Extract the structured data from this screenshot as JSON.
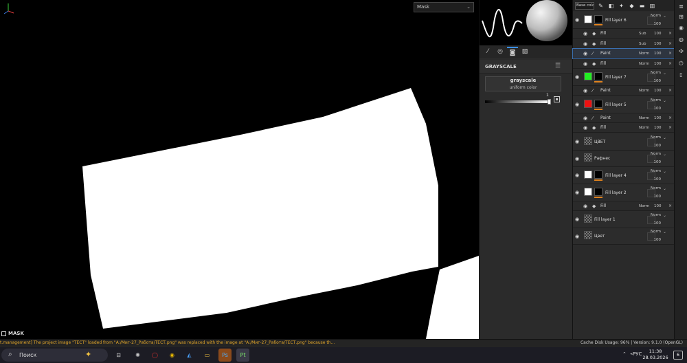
{
  "viewport": {
    "mask_dropdown": "Mask",
    "mode_label": "MASK"
  },
  "properties": {
    "section_title": "GRAYSCALE",
    "grayscale_name": "grayscale",
    "grayscale_sub": "uniform color",
    "slider_value": "1"
  },
  "layers": {
    "toolbar_blend": "Base colo",
    "items": [
      {
        "name": "Fill layer 6",
        "blend": "Norm",
        "opacity": "100",
        "thumb": "#ffffff",
        "orange": true
      },
      {
        "name": "Fill",
        "blend": "Sub",
        "opacity": "100",
        "icon": "fill-icon"
      },
      {
        "name": "Fill",
        "blend": "Sub",
        "opacity": "100",
        "icon": "fill-icon"
      },
      {
        "name": "Paint",
        "blend": "Norm",
        "opacity": "100",
        "icon": "brush-icon"
      },
      {
        "name": "Fill",
        "blend": "Norm",
        "opacity": "100",
        "icon": "fill-icon"
      },
      {
        "name": "Fill layer 7",
        "blend": "Norm",
        "opacity": "100",
        "thumb": "#22ee22",
        "orange": true
      },
      {
        "name": "Paint",
        "blend": "Norm",
        "opacity": "100",
        "icon": "brush-icon"
      },
      {
        "name": "Fill layer 5",
        "blend": "Norm",
        "opacity": "100",
        "thumb": "#ee1111",
        "orange": true
      },
      {
        "name": "Paint",
        "blend": "Norm",
        "opacity": "100",
        "icon": "brush-icon"
      },
      {
        "name": "Fill",
        "blend": "Norm",
        "opacity": "100",
        "icon": "fill-icon"
      },
      {
        "name": "ЦВЕТ",
        "blend": "Norm",
        "opacity": "100"
      },
      {
        "name": "Рафнес",
        "blend": "Norm",
        "opacity": "100"
      },
      {
        "name": "Fill layer 4",
        "blend": "Norm",
        "opacity": "100",
        "thumb": "#ffffff",
        "orange": true
      },
      {
        "name": "Fill layer 2",
        "blend": "Norm",
        "opacity": "100",
        "thumb": "#ffffff",
        "orange": true
      },
      {
        "name": "Fill",
        "blend": "Norm",
        "opacity": "100",
        "icon": "fill-icon"
      },
      {
        "name": "Fill layer 1",
        "blend": "Norm",
        "opacity": "100"
      },
      {
        "name": "Цвет",
        "blend": "Norm",
        "opacity": "100"
      }
    ]
  },
  "log": {
    "message": "t.management] The project image \"ТЕСТ\" loaded from \"A:/Миг-27_Работа/ТЕСТ.png\" was replaced with the image at \"A:/Миг-27_Работа/ТЕСТ.png\" because th...",
    "status": "Cache Disk Usage:  96% | Version: 9.1.0 (OpenGL)"
  },
  "taskbar": {
    "search_placeholder": "Поиск",
    "lang": "РУС",
    "time": "11:38",
    "date": "28.03.2026",
    "notifications": "6",
    "colors": {
      "accent": "#e0821e",
      "selection": "#3a8ee6"
    }
  }
}
